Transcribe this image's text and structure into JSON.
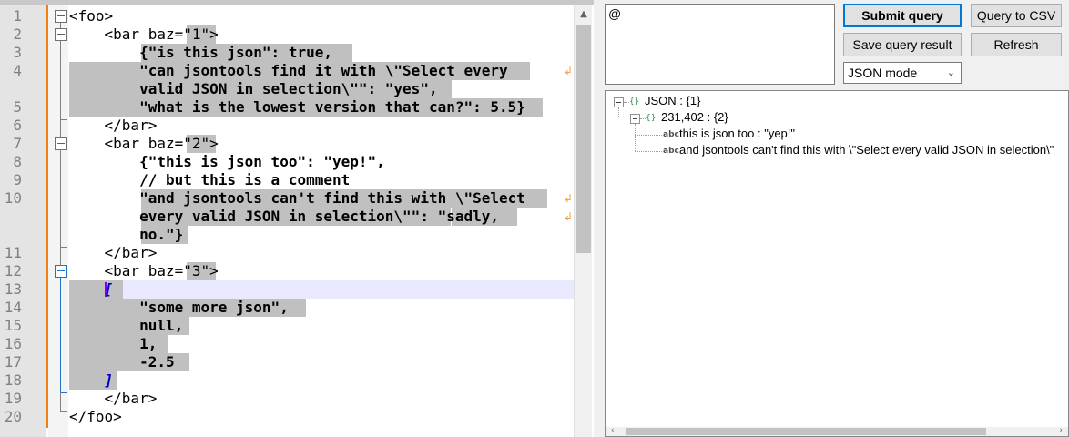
{
  "editor": {
    "line_numbers": [
      "1",
      "2",
      "3",
      "4",
      "5",
      "6",
      "7",
      "8",
      "9",
      "10",
      "11",
      "12",
      "13",
      "14",
      "15",
      "16",
      "17",
      "18",
      "19",
      "20"
    ],
    "lines": [
      "<foo>",
      "    <bar baz=\"1\">",
      "        {\"is this json\": true,",
      "        \"can jsontools find it with \\\"Select every",
      "        valid JSON in selection\\\"\": \"yes\",",
      "        \"what is the lowest version that can?\": 5.5}",
      "    </bar>",
      "    <bar baz=\"2\">",
      "        {\"this is json too\": \"yep!\",",
      "        // but this is a comment",
      "        \"and jsontools can't find this with \\\"Select",
      "        every valid JSON in selection\\\"\": \"sadly,",
      "        no.\"}",
      "    </bar>",
      "    <bar baz=\"3\">",
      "    [",
      "        \"some more json\",",
      "        null,",
      "        1,",
      "        -2.5",
      "    ]",
      "    </bar>",
      "</foo>"
    ]
  },
  "query": {
    "text": "@",
    "submit_label": "Submit query",
    "to_csv_label": "Query to CSV",
    "save_label": "Save query result",
    "refresh_label": "Refresh",
    "mode_selected": "JSON mode"
  },
  "tree": {
    "root_label": "JSON : {1}",
    "child_label": "231,402 : {2}",
    "leaves": [
      "this is json too : \"yep!\"",
      "and jsontools can't find this with \\\"Select every valid JSON in selection\\\""
    ]
  },
  "icons": {
    "fold": "minus-box-icon",
    "wrap": "wrap-arrow-icon",
    "object": "curly-braces-icon",
    "string": "abc-icon"
  },
  "colors": {
    "change_bar": "#f08010",
    "selection": "#c0c0c0",
    "caret_line": "#e8e8ff",
    "default_button_border": "#0078d7"
  }
}
